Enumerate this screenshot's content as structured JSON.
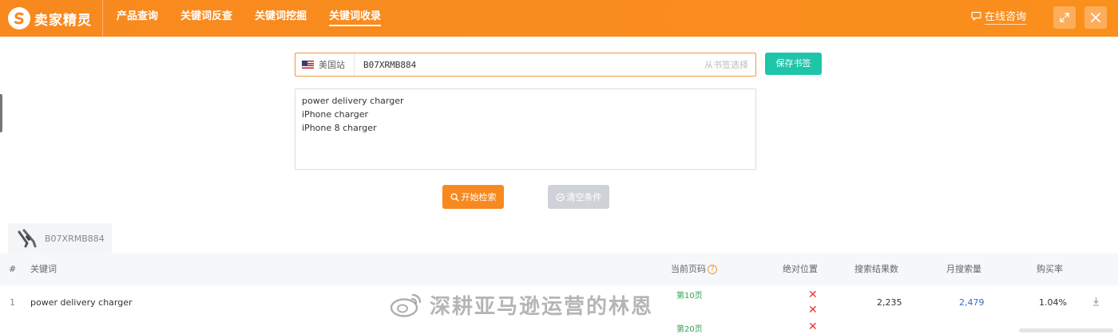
{
  "app": {
    "brand": "卖家精灵"
  },
  "nav": {
    "items": [
      {
        "label": "产品查询",
        "active": false
      },
      {
        "label": "关键词反查",
        "active": false
      },
      {
        "label": "关键词挖掘",
        "active": false
      },
      {
        "label": "关键词收录",
        "active": true
      }
    ]
  },
  "header": {
    "consult_label": "在线咨询"
  },
  "form": {
    "site_label": "美国站",
    "asin_value": "B07XRMB884",
    "bookmark_pick_label": "从书签选择",
    "save_bookmark_label": "保存书签",
    "keywords": [
      "power delivery charger",
      "iPhone charger",
      "iPhone 8 charger"
    ],
    "search_label": "开始检索",
    "clear_label": "清空条件"
  },
  "product_tab": {
    "asin": "B07XRMB884"
  },
  "table": {
    "headers": {
      "index": "#",
      "keyword": "关键词",
      "current_page": "当前页码",
      "absolute_position": "绝对位置",
      "search_results": "搜索结果数",
      "monthly_searches": "月搜索量",
      "purchase_rate": "购买率"
    },
    "rows": [
      {
        "index": "1",
        "keyword": "power delivery charger",
        "page_1": "第10页",
        "page_2": "第20页",
        "search_results": "2,235",
        "monthly_searches": "2,479",
        "purchase_rate": "1.04%"
      }
    ]
  },
  "watermark": {
    "text": "深耕亚马逊运营的林恩"
  },
  "colors": {
    "brand_orange": "#f7891f",
    "teal": "#1ec5a9",
    "link_blue": "#3b6dbf",
    "error_red": "#e33"
  }
}
